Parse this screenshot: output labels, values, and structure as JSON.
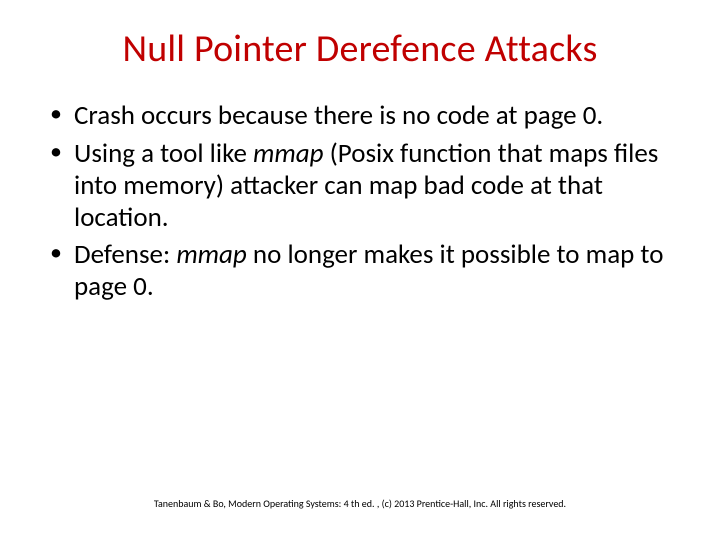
{
  "title": "Null Pointer Derefence Attacks",
  "bullets": [
    {
      "pre": "Crash occurs because there is no code at page 0.",
      "italic": "",
      "post": ""
    },
    {
      "pre": "Using a tool like ",
      "italic": "mmap ",
      "post": "(Posix function that maps files into memory) attacker can map bad code at that location."
    },
    {
      "pre": "Defense:  ",
      "italic": "mmap",
      "post": " no longer makes it possible to map to page 0."
    }
  ],
  "footer": "Tanenbaum & Bo, Modern  Operating Systems: 4 th ed. , (c) 2013 Prentice-Hall, Inc. All rights reserved."
}
